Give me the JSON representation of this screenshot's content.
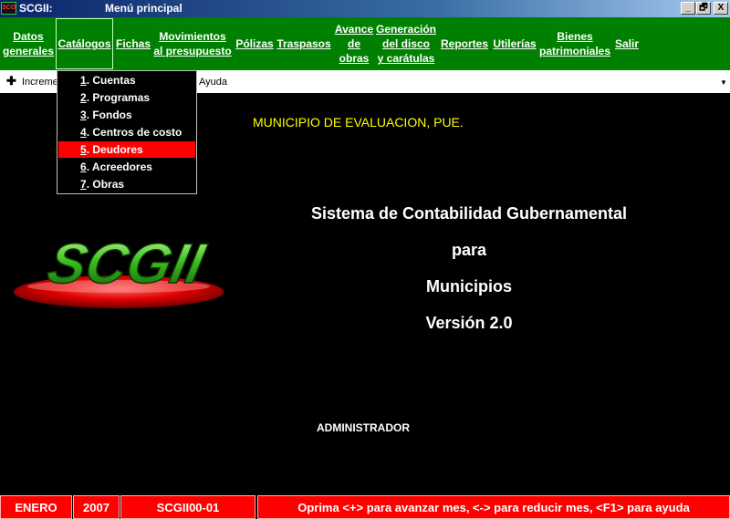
{
  "window": {
    "app_name": "SCGII:",
    "title": "Menú principal",
    "icon_text": "SCG",
    "controls": {
      "minimize": "_",
      "maximize": "🗗",
      "close": "X"
    }
  },
  "menubar": {
    "items": [
      {
        "label": "Datos\ngenerales"
      },
      {
        "label": "Catálogos"
      },
      {
        "label": "Fichas"
      },
      {
        "label": "Movimientos\nal presupuesto"
      },
      {
        "label": "Pólizas"
      },
      {
        "label": "Traspasos"
      },
      {
        "label": "Avance\nde\nobras"
      },
      {
        "label": "Generación\ndel disco\ny carátulas"
      },
      {
        "label": "Reportes"
      },
      {
        "label": "Utilerías"
      },
      {
        "label": "Bienes\npatrimoniales"
      },
      {
        "label": "Salir"
      }
    ]
  },
  "toolbar": {
    "plus": "✚",
    "left_text": "Increme",
    "right_text": "Ayuda",
    "caret": "▼"
  },
  "dropdown": {
    "items": [
      {
        "num": "1",
        "label": ". Cuentas"
      },
      {
        "num": "2",
        "label": ". Programas"
      },
      {
        "num": "3",
        "label": ". Fondos"
      },
      {
        "num": "4",
        "label": ". Centros de costo"
      },
      {
        "num": "5",
        "label": ". Deudores"
      },
      {
        "num": "6",
        "label": ". Acreedores"
      },
      {
        "num": "7",
        "label": ". Obras"
      }
    ],
    "selected_index": 4
  },
  "main": {
    "municipality": "MUNICIPIO DE EVALUACION, PUE.",
    "line1": "Sistema de Contabilidad Gubernamental",
    "line2": "para",
    "line3": "Municipios",
    "line4": "Versión 2.0",
    "user": "ADMINISTRADOR",
    "logo_text": "SCGII"
  },
  "statusbar": {
    "month": "ENERO",
    "year": "2007",
    "module": "SCGII00-01",
    "help": "Oprima <+> para avanzar mes, <-> para reducir mes, <F1> para ayuda"
  },
  "colors": {
    "menubar_bg": "#008000",
    "status_bg": "#ff0000",
    "highlight": "#ff0000",
    "municipality_text": "#ffff00"
  }
}
